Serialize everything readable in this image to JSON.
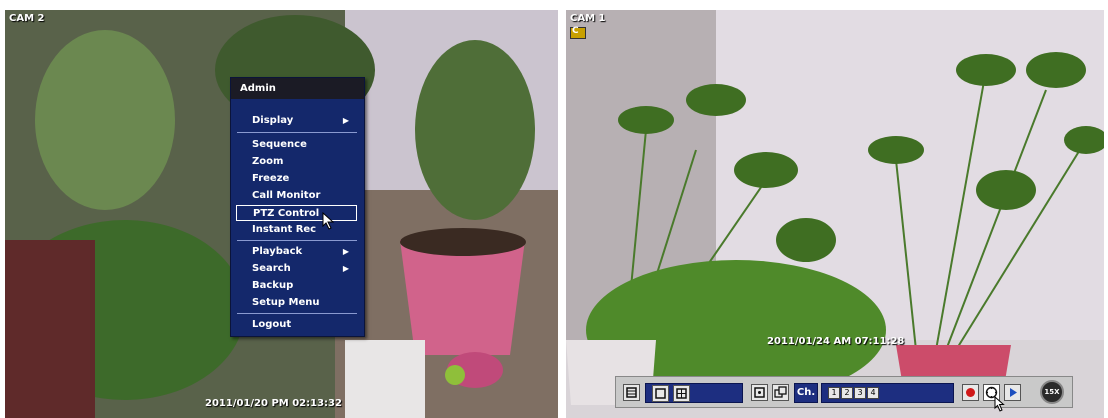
{
  "left_camera": {
    "label": "CAM 2",
    "timestamp": "2011/01/20 PM 02:13:32"
  },
  "right_camera": {
    "label": "CAM 1",
    "indicator": "C",
    "timestamp": "2011/01/24 AM 07:11:28"
  },
  "menu": {
    "header": "Admin",
    "items": [
      {
        "label": "Display",
        "submenu": true
      },
      {
        "label": "Sequence"
      },
      {
        "label": "Zoom"
      },
      {
        "label": "Freeze"
      },
      {
        "label": "Call Monitor"
      },
      {
        "label": "PTZ Control"
      },
      {
        "label": "Instant Rec"
      },
      {
        "label": "Playback",
        "submenu": true
      },
      {
        "label": "Search",
        "submenu": true
      },
      {
        "label": "Backup"
      },
      {
        "label": "Setup Menu"
      },
      {
        "label": "Logout"
      }
    ]
  },
  "toolbar": {
    "channel_label": "Ch.",
    "channels": [
      "1",
      "2",
      "3",
      "4"
    ],
    "zoom_label": "15X",
    "icons": [
      "grid-icon",
      "single-view-icon",
      "quad-view-icon",
      "freeze-icon",
      "sequence-icon",
      "record-icon",
      "ptz-icon",
      "play-icon"
    ]
  },
  "colors": {
    "menu_bg": "#14286b",
    "menu_header": "#1b1b25",
    "toolbar_blue": "#1d2e80",
    "record_red": "#d01818"
  }
}
